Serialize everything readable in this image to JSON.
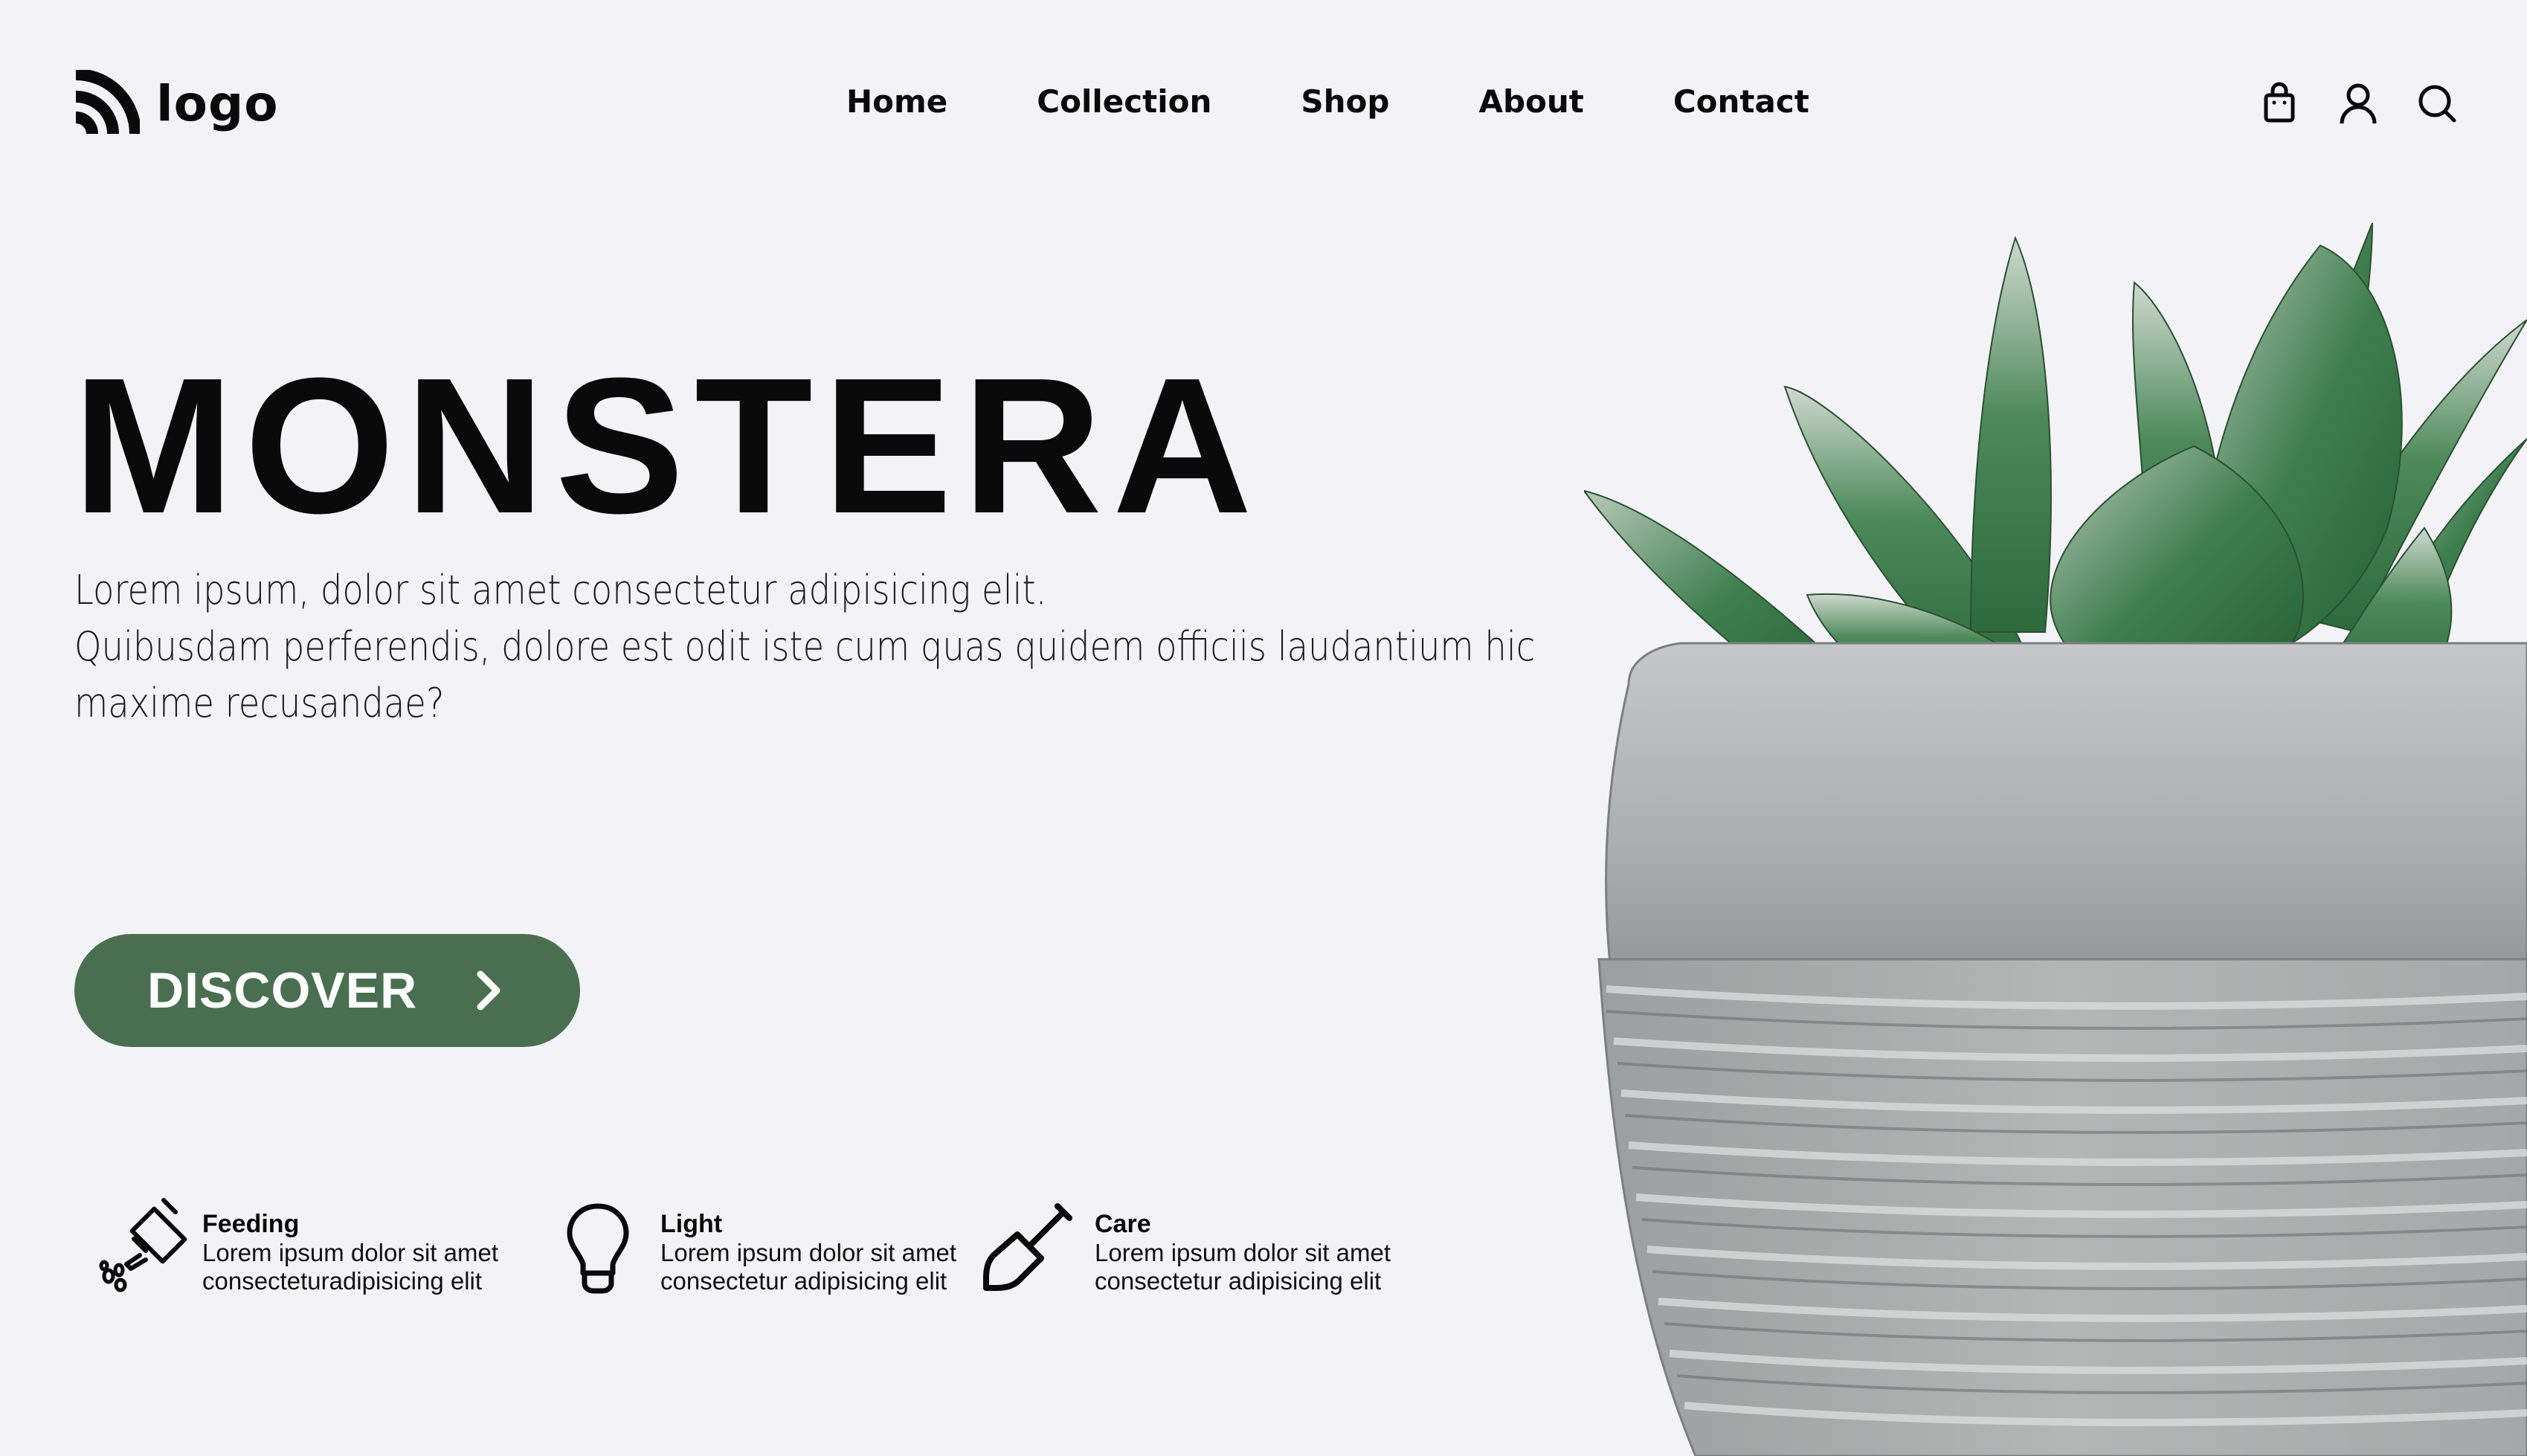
{
  "brand": {
    "logo_text": "logo",
    "logo_icon": "rss-wave-icon"
  },
  "nav": {
    "items": [
      "Home",
      "Collection",
      "Shop",
      "About",
      "Contact"
    ]
  },
  "header_icons": [
    "shopping-bag-icon",
    "user-icon",
    "search-icon"
  ],
  "hero": {
    "title": "MONSTERA",
    "description_lines": [
      "Lorem ipsum, dolor sit amet consectetur adipisicing elit.",
      "Quibusdam perferendis, dolore est odit iste cum quas quidem officiis laudantium hic",
      "maxime recusandae?"
    ],
    "cta_label": "DISCOVER",
    "cta_icon": "chevron-right-icon"
  },
  "features": [
    {
      "title": "Feeding",
      "line1": "Lorem ipsum dolor sit amet",
      "line2": "consecteturadipisicing elit",
      "icon": "watering-can-icon"
    },
    {
      "title": "Light",
      "line1": "Lorem ipsum dolor sit amet",
      "line2": "consectetur adipisicing elit",
      "icon": "light-bulb-icon"
    },
    {
      "title": "Care",
      "line1": "Lorem ipsum dolor sit amet",
      "line2": "consectetur adipisicing elit",
      "icon": "shovel-icon"
    }
  ],
  "colors": {
    "background": "#f3f3f7",
    "accent": "#4a6f50",
    "text": "#0a0a0a"
  }
}
